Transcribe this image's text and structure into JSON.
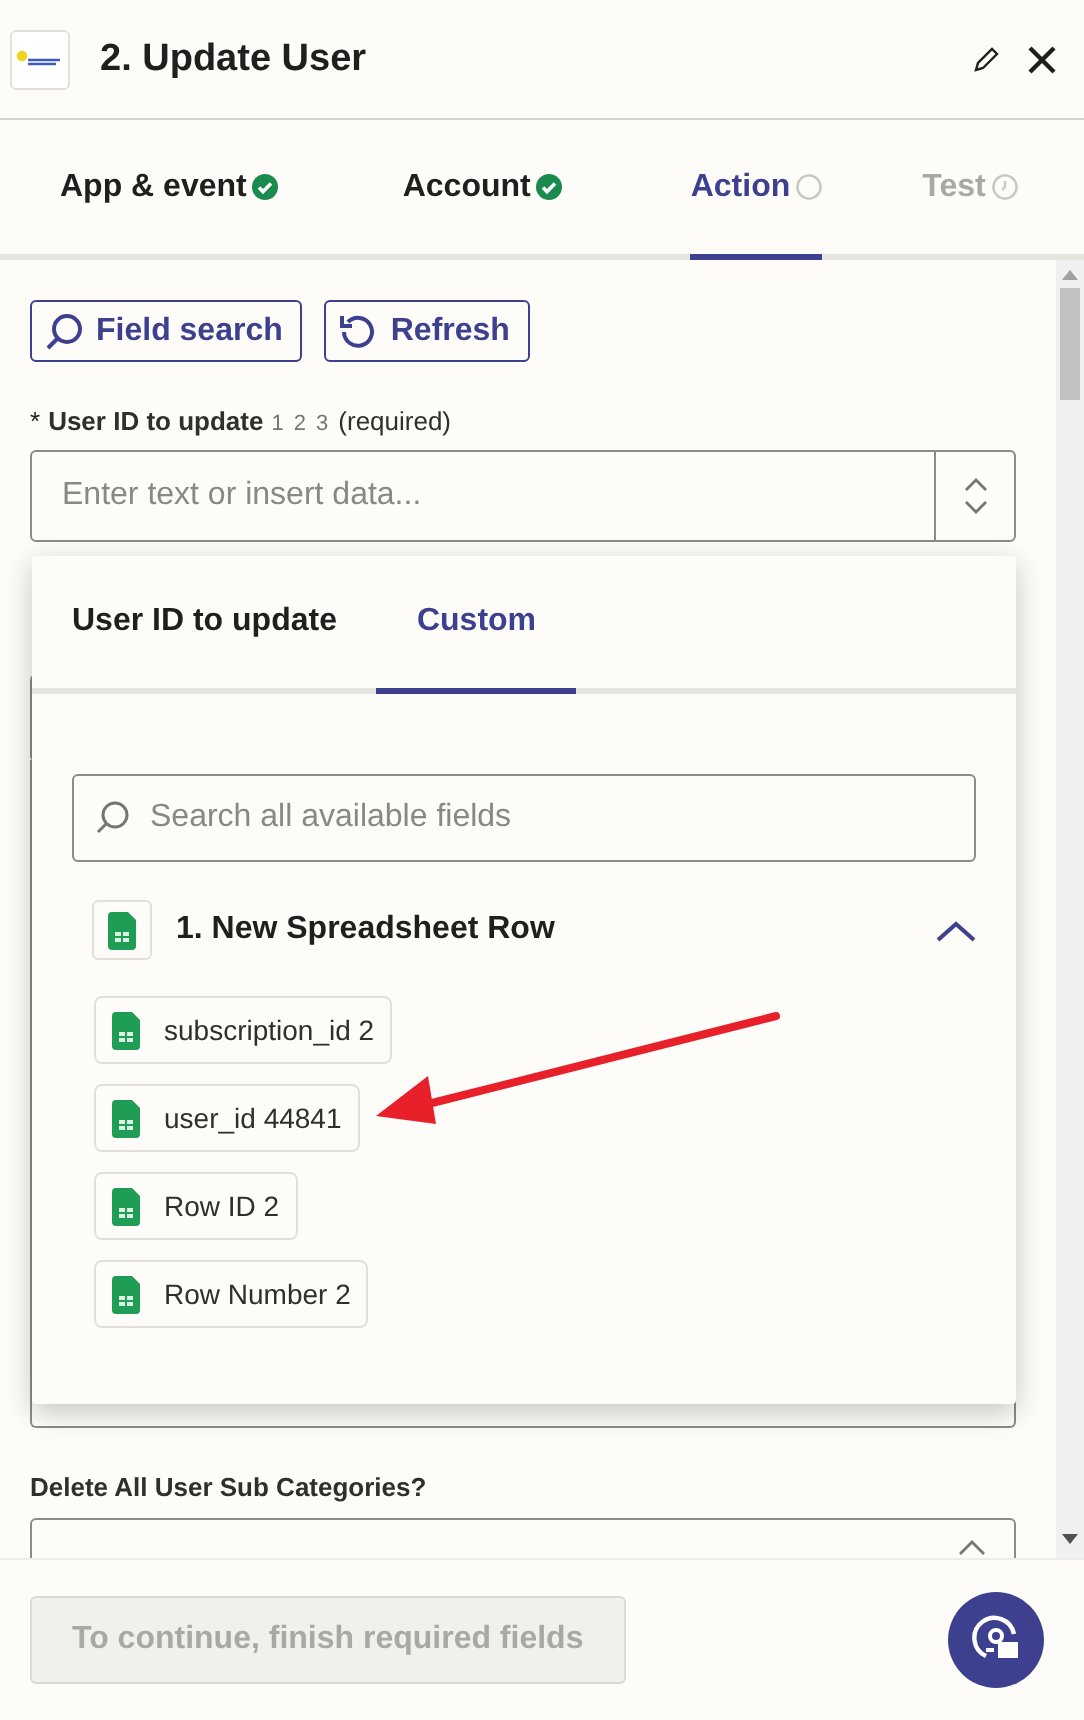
{
  "header": {
    "title": "2. Update User"
  },
  "tabs": [
    {
      "label": "App & event",
      "kind": "done",
      "selected": false,
      "disabled": false
    },
    {
      "label": "Account",
      "kind": "done",
      "selected": false,
      "disabled": false
    },
    {
      "label": "Action",
      "kind": "pending",
      "selected": true,
      "disabled": false
    },
    {
      "label": "Test",
      "kind": "waiting",
      "selected": false,
      "disabled": true
    }
  ],
  "toolbar": [
    {
      "label": "Field search",
      "kind": "search"
    },
    {
      "label": "Refresh",
      "kind": "refresh"
    }
  ],
  "user_id_field": {
    "required_mark": "*",
    "label": "User ID to update",
    "type_hint": "1 2 3",
    "note": "(required)",
    "placeholder": "Enter text or insert data..."
  },
  "picker": {
    "tabs": [
      {
        "label": "User ID to update",
        "selected": false
      },
      {
        "label": "Custom",
        "selected": true
      }
    ],
    "search_placeholder": "Search all available fields",
    "group": {
      "title": "1. New Spreadsheet Row",
      "expanded": true,
      "fields": [
        {
          "name": "subscription_id",
          "value": "2"
        },
        {
          "name": "user_id",
          "value": "44841"
        },
        {
          "name": "Row ID",
          "value": "2"
        },
        {
          "name": "Row Number",
          "value": "2"
        }
      ]
    }
  },
  "delete_field": {
    "label": "Delete All User Sub Categories?"
  },
  "footer": {
    "continue_button": "To continue, finish required fields",
    "continue_disabled": true
  }
}
